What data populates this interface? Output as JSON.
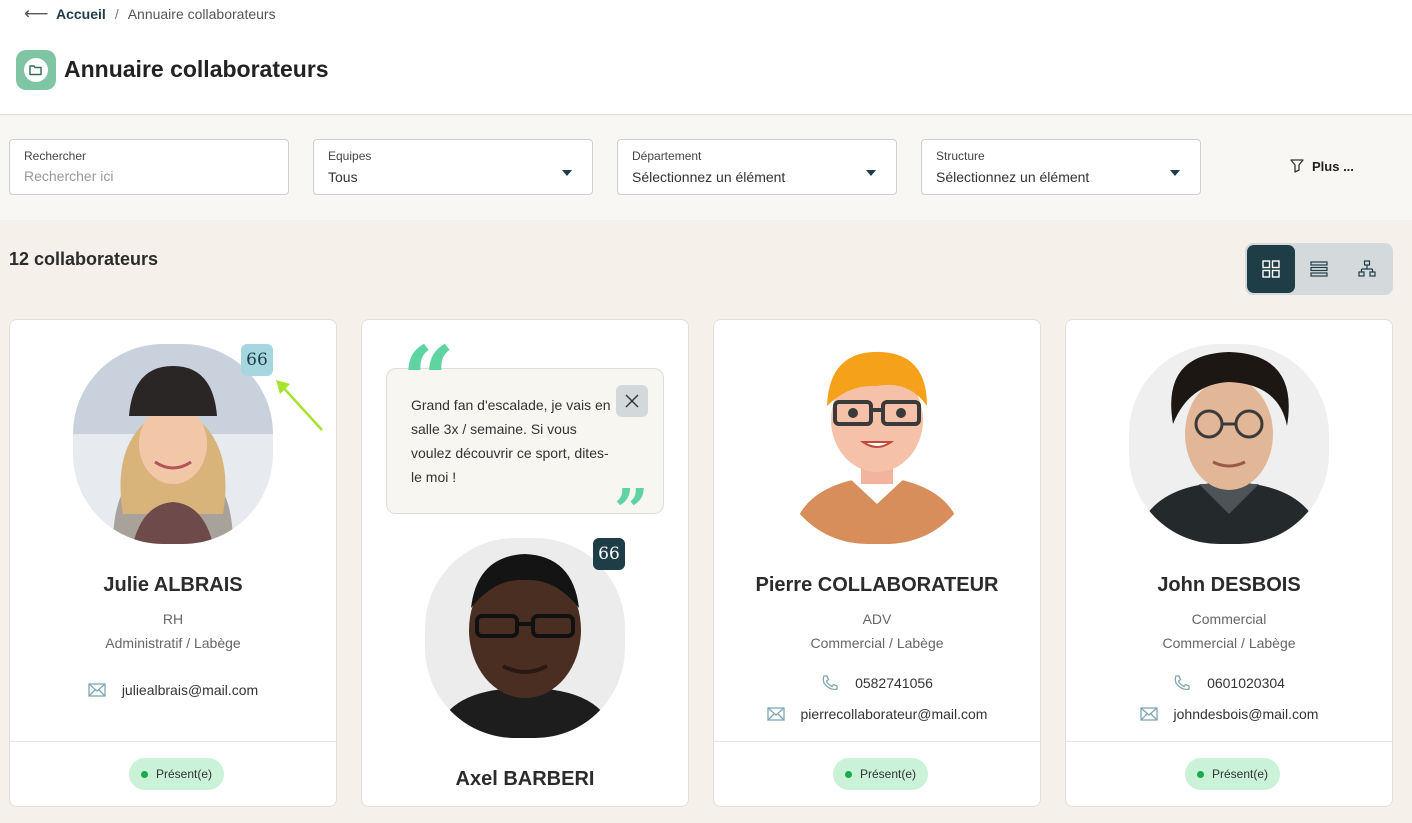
{
  "breadcrumb": {
    "home": "Accueil",
    "separator": "/",
    "current": "Annuaire collaborateurs"
  },
  "page": {
    "title": "Annuaire collaborateurs"
  },
  "filters": {
    "search": {
      "label": "Rechercher",
      "placeholder": "Rechercher ici"
    },
    "teams": {
      "label": "Equipes",
      "value": "Tous"
    },
    "department": {
      "label": "Département",
      "value": "Sélectionnez un élément"
    },
    "structure": {
      "label": "Structure",
      "value": "Sélectionnez un élément"
    },
    "more_label": "Plus ..."
  },
  "summary": {
    "count_label": "12 collaborateurs"
  },
  "view_toggle": {
    "active": "grid",
    "options": [
      "grid",
      "list",
      "org-chart"
    ]
  },
  "colors": {
    "primary": "#1e3d46",
    "accent_green": "#5fd4a2",
    "status_bg": "#c9f2d9",
    "status_dot": "#1fa84a",
    "background": "#f5f1ea"
  },
  "cards": [
    {
      "name": "Julie ALBRAIS",
      "role": "RH",
      "location": "Administratif / Labège",
      "email": "juliealbrais@mail.com",
      "status": "Présent(e)",
      "quote_icon": "66"
    },
    {
      "name": "Axel BARBERI",
      "quote": "Grand fan d'escalade, je vais en salle 3x / semaine. Si vous voulez découvrir ce sport, dites-le moi !",
      "quote_icon": "66",
      "open_quote": "“",
      "close_quote": "”"
    },
    {
      "name": "Pierre COLLABORATEUR",
      "role": "ADV",
      "location": "Commercial / Labège",
      "phone": "0582741056",
      "email": "pierrecollaborateur@mail.com",
      "status": "Présent(e)"
    },
    {
      "name": "John DESBOIS",
      "role": "Commercial",
      "location": "Commercial / Labège",
      "phone": "0601020304",
      "email": "johndesbois@mail.com",
      "status": "Présent(e)"
    }
  ]
}
